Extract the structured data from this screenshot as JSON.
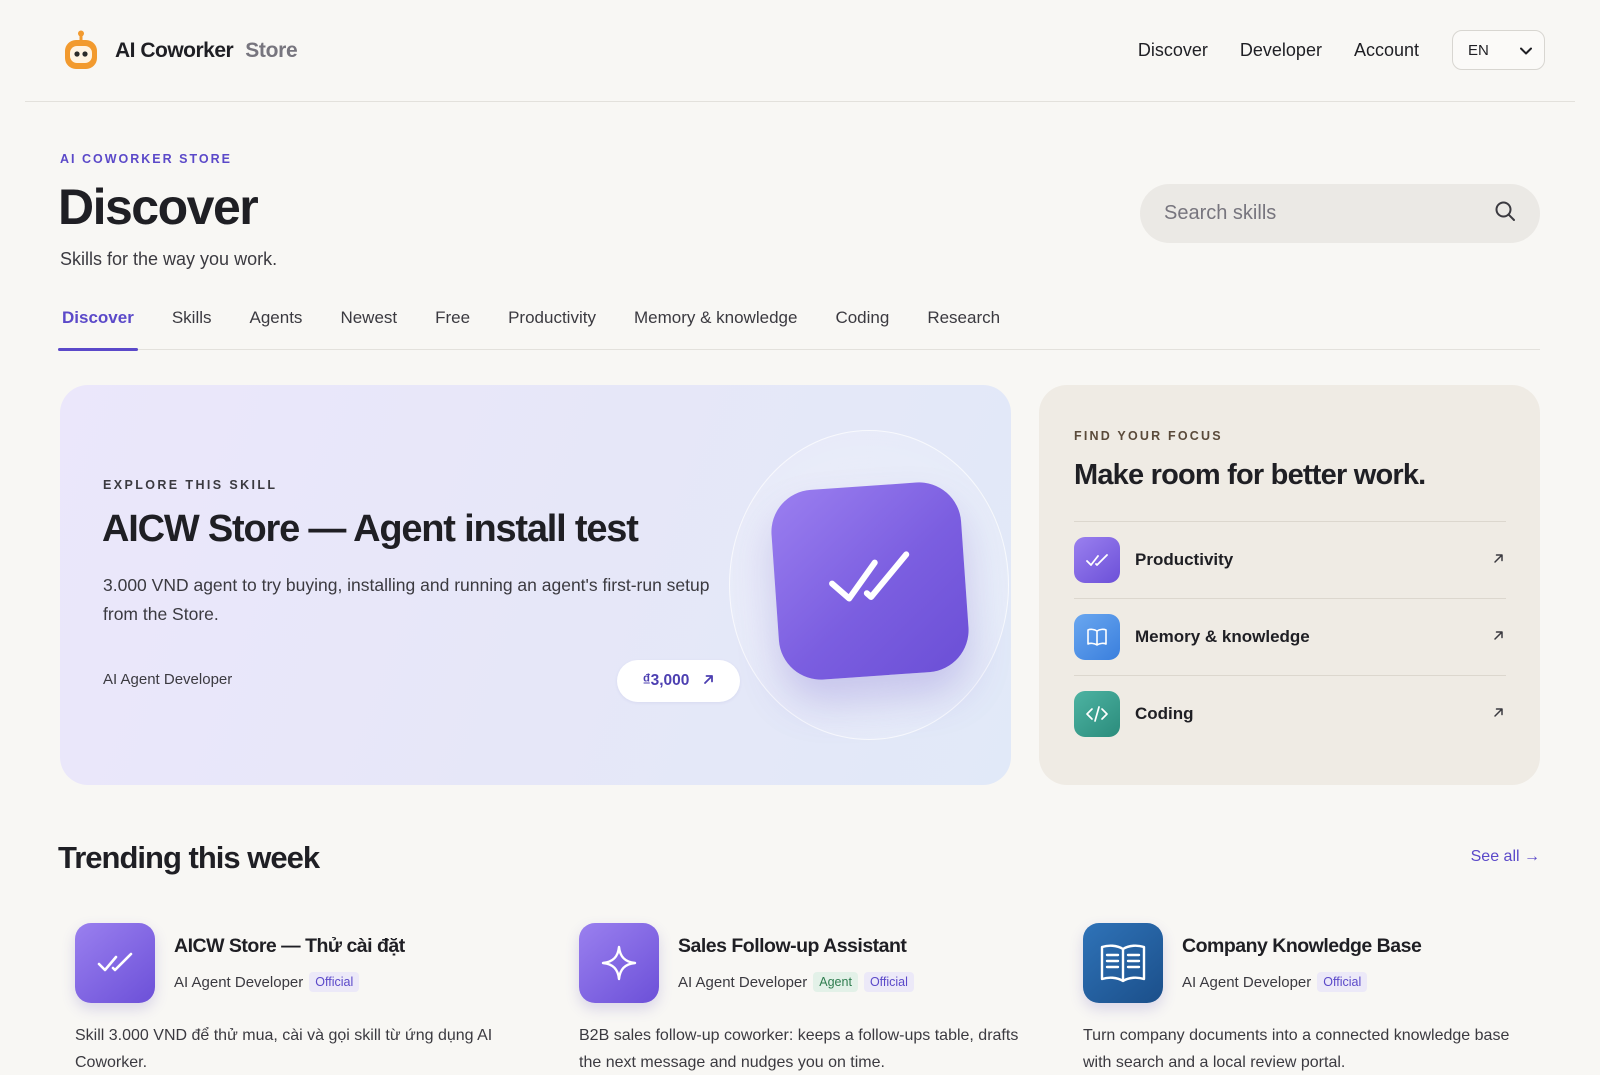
{
  "brand": {
    "name": "AI Coworker",
    "store": "Store"
  },
  "topnav": {
    "discover": "Discover",
    "developer": "Developer",
    "account": "Account",
    "language": "EN"
  },
  "page": {
    "eyebrow": "AI COWORKER STORE",
    "title": "Discover",
    "subtitle": "Skills for the way you work.",
    "search_placeholder": "Search skills"
  },
  "tabs": [
    "Discover",
    "Skills",
    "Agents",
    "Newest",
    "Free",
    "Productivity",
    "Memory & knowledge",
    "Coding",
    "Research"
  ],
  "feature": {
    "eyebrow": "EXPLORE THIS SKILL",
    "title": "AICW Store — Agent install test",
    "description": "3.000 VND agent to try buying, installing and running an agent's first-run setup from the Store.",
    "developer": "AI Agent Developer",
    "price": "₫3,000"
  },
  "focus": {
    "eyebrow": "FIND YOUR FOCUS",
    "title": "Make room for better work.",
    "items": [
      {
        "label": "Productivity",
        "icon": "double-check-icon",
        "color": "#7b5ee0"
      },
      {
        "label": "Memory & knowledge",
        "icon": "book-icon",
        "color": "#4a8fe6"
      },
      {
        "label": "Coding",
        "icon": "code-icon",
        "color": "#2f9a8a"
      }
    ]
  },
  "trending": {
    "title": "Trending this week",
    "see_all": "See all →",
    "cards": [
      {
        "title": "AICW Store — Thử cài đặt",
        "developer": "AI Agent Developer",
        "badges": [
          "Official"
        ],
        "description": "Skill 3.000 VND để thử mua, cài và gọi skill từ ứng dụng AI Coworker.",
        "icon": "double-check-icon"
      },
      {
        "title": "Sales Follow-up Assistant",
        "developer": "AI Agent Developer",
        "badges": [
          "Agent",
          "Official"
        ],
        "description": "B2B sales follow-up coworker: keeps a follow-ups table, drafts the next message and nudges you on time.",
        "icon": "sparkle-icon"
      },
      {
        "title": "Company Knowledge Base",
        "developer": "AI Agent Developer",
        "badges": [
          "Official"
        ],
        "description": "Turn company documents into a connected knowledge base with search and a local review portal.",
        "icon": "book-icon"
      }
    ]
  },
  "colors": {
    "accent": "#5b49c9",
    "background": "#f8f7f4",
    "brand_orange": "#f29a2e"
  }
}
